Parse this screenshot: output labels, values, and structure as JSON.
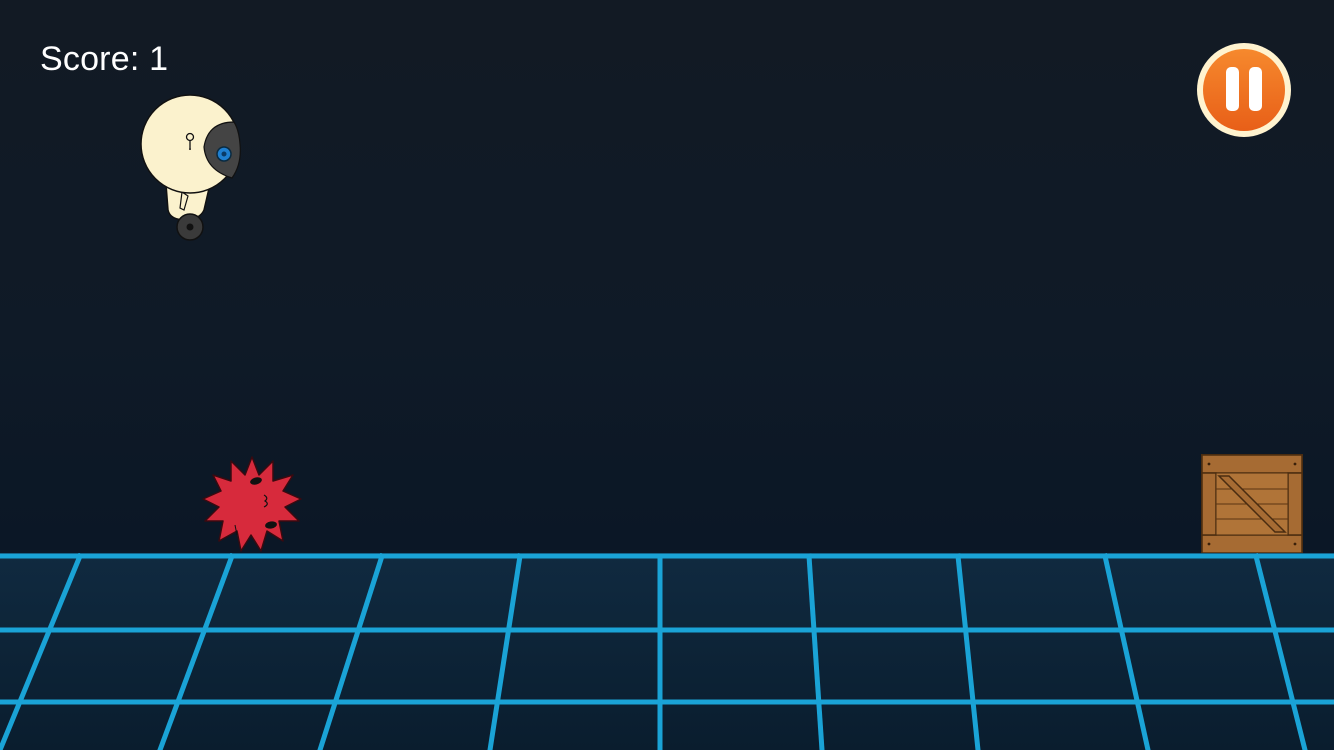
{
  "hud": {
    "score_label": "Score:",
    "score_value": "1"
  },
  "colors": {
    "background": "#111a23",
    "grid_line": "#1aa3d6",
    "pause_orange": "#f07520",
    "pause_rim": "#fff3cf",
    "spike_red": "#d72a3c",
    "crate_wood": "#9b6530",
    "robot_body": "#fbf2cd",
    "robot_visor": "#3e3e3e",
    "robot_eye": "#1f7fd0"
  },
  "icons": {
    "pause": "pause-icon",
    "player": "robot-player",
    "hazard": "red-spike-ball",
    "obstacle": "wooden-crate"
  }
}
